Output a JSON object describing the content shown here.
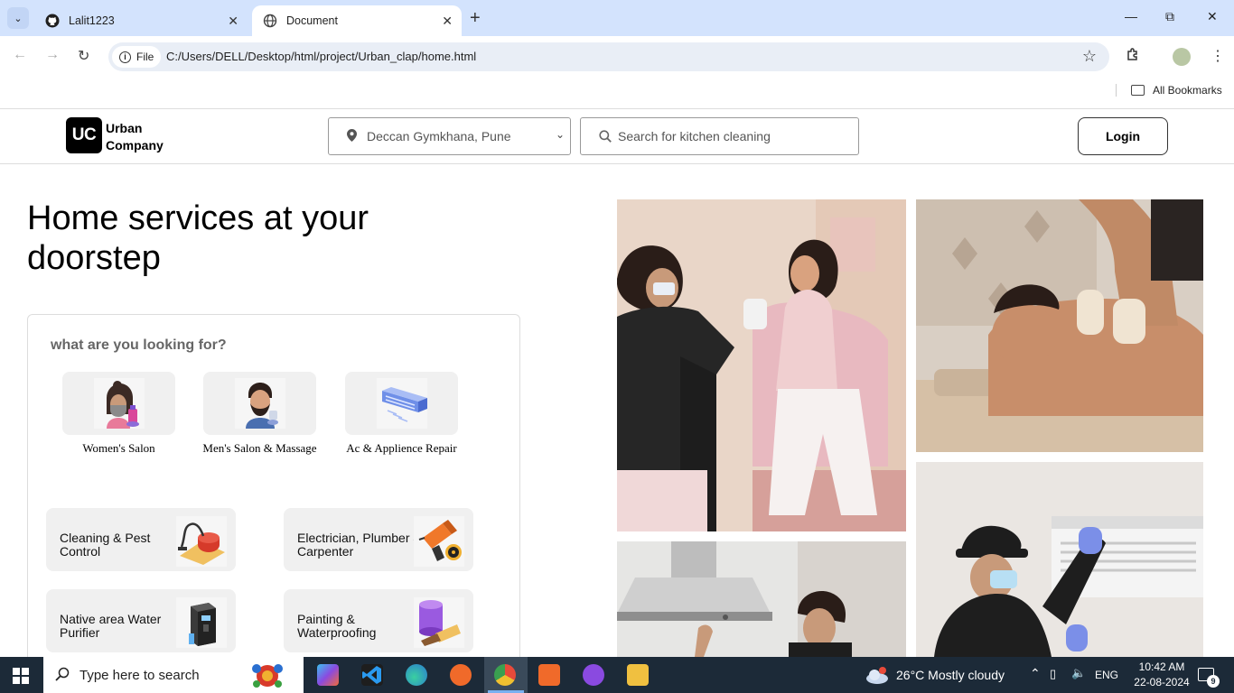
{
  "browser": {
    "tabs": [
      {
        "label": "Lalit1223",
        "favicon": "github-icon"
      },
      {
        "label": "Document",
        "favicon": "globe-icon"
      }
    ],
    "chip_label": "File",
    "url": "C:/Users/DELL/Desktop/html/project/Urban_clap/home.html",
    "bookmarks_label": "All Bookmarks"
  },
  "header": {
    "logo_mark": "UC",
    "logo_line1": "Urban",
    "logo_line2": "Company",
    "location": "Deccan Gymkhana, Pune",
    "search_placeholder": "Search for kitchen cleaning",
    "login_label": "Login"
  },
  "hero": {
    "title": "Home services at your doorstep"
  },
  "finder": {
    "question": "what are you looking for?",
    "services": [
      {
        "label": "Women's Salon",
        "icon": "women-salon-icon"
      },
      {
        "label": "Men's Salon & Massage",
        "icon": "men-salon-icon"
      },
      {
        "label": "Ac & Applience Repair",
        "icon": "ac-repair-icon"
      }
    ],
    "categories": [
      {
        "label": "Cleaning & Pest Control",
        "icon": "vacuum-icon"
      },
      {
        "label": "Electrician, Plumber & Carpenter",
        "icon": "drill-icon"
      },
      {
        "label": "Native area Water Purifier",
        "icon": "water-purifier-icon"
      },
      {
        "label": "Painting & Waterproofing",
        "icon": "paint-bucket-icon"
      }
    ]
  },
  "photos": [
    "salon-photo",
    "massage-photo",
    "kitchen-chimney-photo",
    "ac-service-photo"
  ],
  "taskbar": {
    "search_placeholder": "Type here to search",
    "weather": "26°C  Mostly cloudy",
    "lang": "ENG",
    "time": "10:42 AM",
    "date": "22-08-2024",
    "notif_count": "9"
  }
}
